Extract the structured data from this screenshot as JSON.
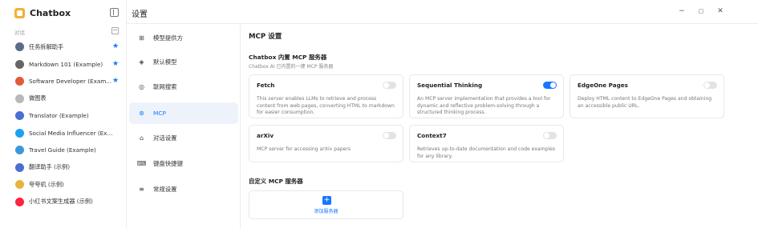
{
  "app": {
    "name": "Chatbox"
  },
  "sidebar": {
    "section_label": "对话",
    "items": [
      {
        "label": "任务拆解助手",
        "icon": "rocket-icon",
        "pinned": true,
        "color": "#5b6b8c"
      },
      {
        "label": "Markdown 101 (Example)",
        "icon": "chat-bubble-icon",
        "pinned": true,
        "color": "#666666"
      },
      {
        "label": "Software Developer (Exam...",
        "icon": "developer-avatar-icon",
        "pinned": true,
        "color": "#e05a3a"
      },
      {
        "label": "做图表",
        "icon": "chart-avatar-icon",
        "pinned": false,
        "color": "#b9b9b9"
      },
      {
        "label": "Translator (Example)",
        "icon": "translator-avatar-icon",
        "pinned": false,
        "color": "#4a6fd1"
      },
      {
        "label": "Social Media Influencer (Example)",
        "icon": "twitter-icon",
        "pinned": false,
        "color": "#1da1f2"
      },
      {
        "label": "Travel Guide (Example)",
        "icon": "globe-avatar-icon",
        "pinned": false,
        "color": "#3a9ad9"
      },
      {
        "label": "翻译助手 (示例)",
        "icon": "translator-avatar-icon",
        "pinned": false,
        "color": "#4a6fd1"
      },
      {
        "label": "夸夸机 (示例)",
        "icon": "sparkle-avatar-icon",
        "pinned": false,
        "color": "#e6b43c"
      },
      {
        "label": "小红书文案生成器 (示例)",
        "icon": "xiaohongshu-icon",
        "pinned": false,
        "color": "#ff2442"
      }
    ]
  },
  "header": {
    "title": "设置"
  },
  "window_controls": {
    "minimize": "−",
    "maximize": "▢",
    "close": "✕"
  },
  "settings_nav": {
    "active_index": 3,
    "items": [
      {
        "label": "模型提供方",
        "icon": "grid-icon",
        "glyph": "⊞"
      },
      {
        "label": "默认模型",
        "icon": "cube-icon",
        "glyph": "◈"
      },
      {
        "label": "联网搜索",
        "icon": "globe-icon",
        "glyph": "◎"
      },
      {
        "label": "MCP",
        "icon": "mcp-icon",
        "glyph": "⊛"
      },
      {
        "label": "对话设置",
        "icon": "chat-settings-icon",
        "glyph": "⌂"
      },
      {
        "label": "键盘快捷键",
        "icon": "keyboard-icon",
        "glyph": "⌨"
      },
      {
        "label": "常规设置",
        "icon": "sliders-icon",
        "glyph": "≡"
      }
    ]
  },
  "main": {
    "title": "MCP 设置",
    "builtin_title": "Chatbox 内置 MCP 服务器",
    "builtin_subtitle": "Chatbox AI 已内置的一键 MCP 服务器",
    "servers": [
      {
        "name": "Fetch",
        "description": "This server enables LLMs to retrieve and process content from web pages, converting HTML to markdown for easier consumption.",
        "enabled": false
      },
      {
        "name": "Sequential Thinking",
        "description": "An MCP server implementation that provides a tool for dynamic and reflective problem-solving through a structured thinking process.",
        "enabled": true
      },
      {
        "name": "EdgeOne Pages",
        "description": "Deploy HTML content to EdgeOne Pages and obtaining an accessible public URL.",
        "enabled": false
      },
      {
        "name": "arXiv",
        "description": "MCP server for accessing arXiv papers",
        "enabled": false
      },
      {
        "name": "Context7",
        "description": "Retrieves up-to-date documentation and code examples for any library.",
        "enabled": false
      }
    ],
    "custom_title": "自定义 MCP 服务器",
    "add_server_label": "添加服务器",
    "add_icon": "+"
  },
  "colors": {
    "accent": "#1677ff",
    "active_nav_bg": "#eef3fb",
    "border": "#e8e8e8"
  }
}
